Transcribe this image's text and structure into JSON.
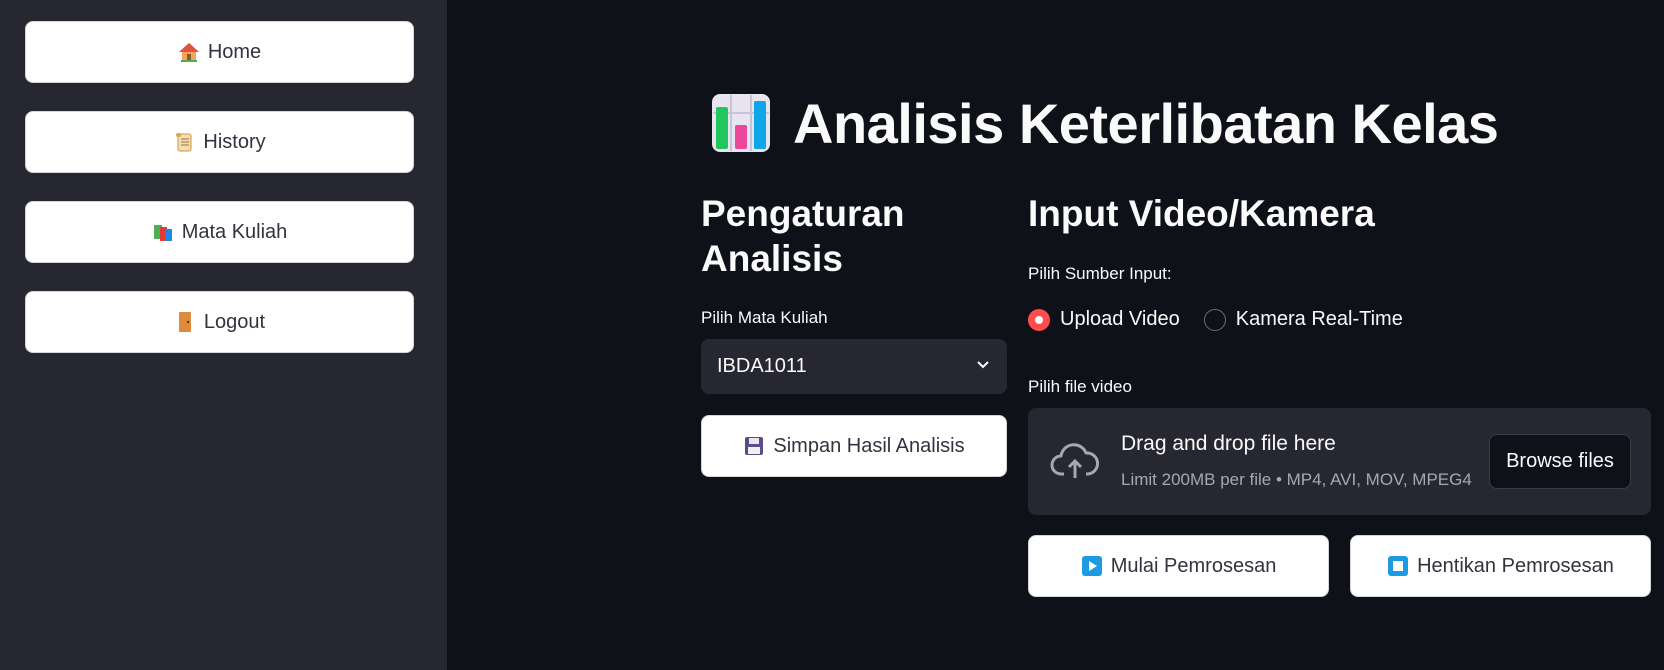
{
  "sidebar": {
    "items": [
      {
        "label": "Home",
        "icon": "house-icon"
      },
      {
        "label": "History",
        "icon": "scroll-icon"
      },
      {
        "label": "Mata Kuliah",
        "icon": "books-icon"
      },
      {
        "label": "Logout",
        "icon": "door-icon"
      }
    ]
  },
  "header": {
    "title": "Analisis Keterlibatan Kelas",
    "icon": "bar-chart-icon"
  },
  "settings": {
    "heading_line1": "Pengaturan",
    "heading_line2": "Analisis",
    "course_label": "Pilih Mata Kuliah",
    "course_value": "IBDA1011",
    "save_label": "Simpan Hasil Analisis"
  },
  "input": {
    "heading": "Input Video/Kamera",
    "source_label": "Pilih Sumber Input:",
    "options": [
      "Upload Video",
      "Kamera Real-Time"
    ],
    "selected": "Upload Video",
    "file_label": "Pilih file video",
    "drop_text": "Drag and drop file here",
    "limit_text": "Limit 200MB per file • MP4, AVI, MOV, MPEG4",
    "browse_label": "Browse files",
    "start_label": "Mulai Pemrosesan",
    "stop_label": "Hentikan Pemrosesan"
  },
  "colors": {
    "accent": "#ff4b4b",
    "background": "#0e1117",
    "sidebar": "#262730"
  }
}
